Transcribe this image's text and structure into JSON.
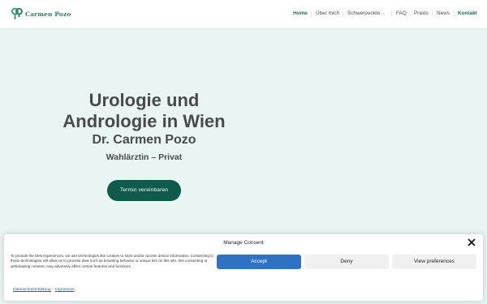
{
  "header": {
    "logo_text": "Carmen Pozo",
    "nav": [
      {
        "label": "Home"
      },
      {
        "label": "Über mich"
      },
      {
        "label": "Schwerpunkte"
      },
      {
        "label": "FAQ"
      },
      {
        "label": "Praxis"
      },
      {
        "label": "News"
      },
      {
        "label": "Kontakt"
      }
    ],
    "colors": {
      "accent": "#1f6e5b",
      "logo": "#2f7d6a"
    }
  },
  "hero": {
    "title_line1": "Urologie und",
    "title_line2": "Andrologie in Wien",
    "name": "Dr. Carmen Pozo",
    "subtitle": "Wahlärztin – Privat",
    "cta_label": "Termin vereinbaren",
    "background": "#e9f5f2",
    "cta_color": "#0f5a4b"
  },
  "consent": {
    "title": "Manage Consent",
    "text": "To provide the best experiences, we use technologies like cookies to store and/or access device information. Consenting to these technologies will allow us to process data such as browsing behavior or unique IDs on this site. Not consenting or withdrawing consent, may adversely affect certain features and functions.",
    "accept_label": "Accept",
    "deny_label": "Deny",
    "prefs_label": "View preferences",
    "links": [
      "Datenschutzerklärung",
      "Impressum"
    ],
    "accept_color": "#2f72c4"
  }
}
